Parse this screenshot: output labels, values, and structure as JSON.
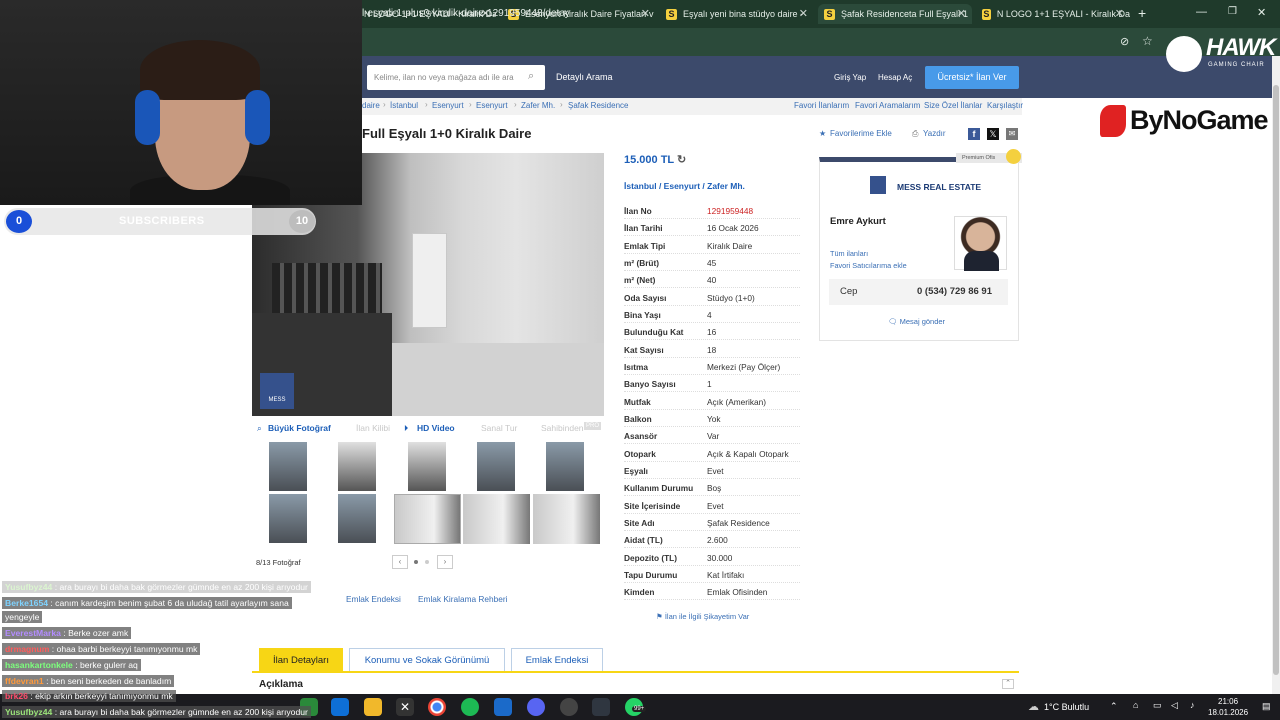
{
  "browser": {
    "tabs": [
      {
        "label": "N LOGO 1+1 EŞYALI - Kiralık Da",
        "active": false
      },
      {
        "label": "Esenyurt Kiralık Daire Fiyatları v",
        "active": false
      },
      {
        "label": "Eşyalı yeni bina stüdyo daire - ",
        "active": false
      },
      {
        "label": "Şafak Residenceta Full Eşyalı 1",
        "active": true
      },
      {
        "label": "N LOGO 1+1 EŞYALI - Kiralık Da",
        "active": false
      }
    ],
    "new_tab": "+",
    "url": "l-esyali-1-plus0-kiralik-daire-1291959448/detay"
  },
  "site": {
    "search_placeholder": "Kelime, ilan no veya mağaza adı ile ara",
    "detailed_search": "Detaylı Arama",
    "login": "Giriş Yap",
    "register": "Hesap Aç",
    "post_ad": "Ücretsiz* İlan Ver"
  },
  "breadcrumbs": [
    "daire",
    "İstanbul",
    "Esenyurt",
    "Esenyurt",
    "Zafer Mh.",
    "Şafak Residence"
  ],
  "tools": [
    "Favori İlanlarım",
    "Favori Aramalarım",
    "Size Özel İlanlar",
    "Karşılaştır"
  ],
  "listing": {
    "title": "Full Eşyalı 1+0 Kiralık Daire",
    "add_favorite": "Favorilerime Ekle",
    "print": "Yazdır",
    "price": "15.000 TL",
    "location": "İstanbul  /  Esenyurt  /  Zafer Mh.",
    "details": [
      {
        "k": "İlan No",
        "v": "1291959448"
      },
      {
        "k": "İlan Tarihi",
        "v": "16 Ocak 2026"
      },
      {
        "k": "Emlak Tipi",
        "v": "Kiralık Daire"
      },
      {
        "k": "m² (Brüt)",
        "v": "45"
      },
      {
        "k": "m² (Net)",
        "v": "40"
      },
      {
        "k": "Oda Sayısı",
        "v": "Stüdyo (1+0)"
      },
      {
        "k": "Bina Yaşı",
        "v": "4"
      },
      {
        "k": "Bulunduğu Kat",
        "v": "16"
      },
      {
        "k": "Kat Sayısı",
        "v": "18"
      },
      {
        "k": "Isıtma",
        "v": "Merkezi (Pay Ölçer)"
      },
      {
        "k": "Banyo Sayısı",
        "v": "1"
      },
      {
        "k": "Mutfak",
        "v": "Açık (Amerikan)"
      },
      {
        "k": "Balkon",
        "v": "Yok"
      },
      {
        "k": "Asansör",
        "v": "Var"
      },
      {
        "k": "Otopark",
        "v": "Açık & Kapalı Otopark"
      },
      {
        "k": "Eşyalı",
        "v": "Evet"
      },
      {
        "k": "Kullanım Durumu",
        "v": "Boş"
      },
      {
        "k": "Site İçerisinde",
        "v": "Evet"
      },
      {
        "k": "Site Adı",
        "v": "Şafak Residence"
      },
      {
        "k": "Aidat (TL)",
        "v": "2.600"
      },
      {
        "k": "Depozito (TL)",
        "v": "30.000"
      },
      {
        "k": "Tapu Durumu",
        "v": "Kat İrtifakı"
      },
      {
        "k": "Kimden",
        "v": "Emlak Ofisinden"
      }
    ],
    "complaint": "İlan ile İlgili Şikayetim Var",
    "photo_watermark": "MESS",
    "photo_tools": {
      "big_photo": "Büyük Fotoğraf",
      "ad_map": "İlan Kilibi",
      "hd_video": "HD Video",
      "virtual_tour": "Sanal Tur",
      "owner": "Sahibinden",
      "badge": "PRO"
    },
    "photo_count": "8/13 Fotoğraf"
  },
  "seller": {
    "premium": "Premium Ofis",
    "firm": "MESS REAL ESTATE",
    "agent": "Emre Aykurt",
    "all_ads": "Tüm ilanları",
    "favorite_seller": "Favori Satıcılarıma ekle",
    "phone_label": "Cep",
    "phone": "0 (534) 729 86 91",
    "message": "Mesaj gönder"
  },
  "bottom": {
    "links": [
      "Emlak Endeksi",
      "Emlak Kiralama Rehberi"
    ],
    "tabs": [
      "İlan Detayları",
      "Konumu ve Sokak Görünümü",
      "Emlak Endeksi"
    ],
    "section": "Açıklama"
  },
  "stream": {
    "subs_current": "0",
    "subs_label": "SUBSCRIBERS",
    "subs_goal": "10",
    "hawk": "HAWK",
    "hawk_sub": "GAMING CHAIR",
    "bynogame": "ByNoGame",
    "chat": [
      {
        "user": "Yusufbyz44",
        "msg": ": ara burayı bi daha bak görmezler gümnde en az 200 kişi arıyodur",
        "color": "#9be37a"
      },
      {
        "user": "Berke1654",
        "msg": ": canım kardeşim benim şubat 6 da uludağ tatil ayarlayım sana",
        "color": "#7fd3ff"
      },
      {
        "user": "",
        "msg": "yengeyle",
        "color": "#fff"
      },
      {
        "user": "EverestMarka",
        "msg": ": Berke ozer amk",
        "color": "#b38cff"
      },
      {
        "user": "drmagnum",
        "msg": ": ohaa barbi berkeyyi tanımıyonmu mk",
        "color": "#ff5b5b"
      },
      {
        "user": "hasankartonkele",
        "msg": ": berke gulerr aq",
        "color": "#7dff7d"
      },
      {
        "user": "ffdevran1",
        "msg": ": ben seni berkeden de banladım",
        "color": "#ff9a3c"
      },
      {
        "user": "brk26",
        "msg": ": ekip arkın berkeyyi tanımıyonmu mk",
        "color": "#ff4d6d"
      },
      {
        "user": "Yusufbyz44",
        "msg": ": ara burayı bi daha bak görmezler gümnde en az 200 kişi arıyodur",
        "color": "#9be37a"
      }
    ]
  },
  "taskbar": {
    "weather": "1°C  Bulutlu",
    "time": "21:06",
    "date": "18.01.2026",
    "badge": "99+"
  }
}
